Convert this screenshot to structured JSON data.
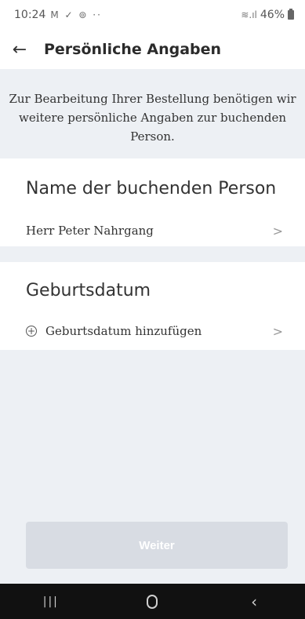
{
  "status_bar": {
    "time": "10:24",
    "icons": "M ✓ ⊚ ··",
    "signal_icons": "≋.ıl",
    "battery": "46%"
  },
  "header": {
    "back_icon": "←",
    "title": "Persönliche Angaben"
  },
  "info": {
    "text": "Zur Bearbeitung Ihrer Bestellung benötigen wir weitere persönliche Angaben zur buchenden Person."
  },
  "booking_person": {
    "section_title": "Name der buchenden Person",
    "name": "Herr Peter Nahrgang"
  },
  "birthdate": {
    "section_title": "Geburtsdatum",
    "add_label": "Geburtsdatum hinzufügen"
  },
  "footer": {
    "continue_label": "Weiter"
  },
  "nav": {
    "recent": "|||",
    "back": "‹"
  }
}
